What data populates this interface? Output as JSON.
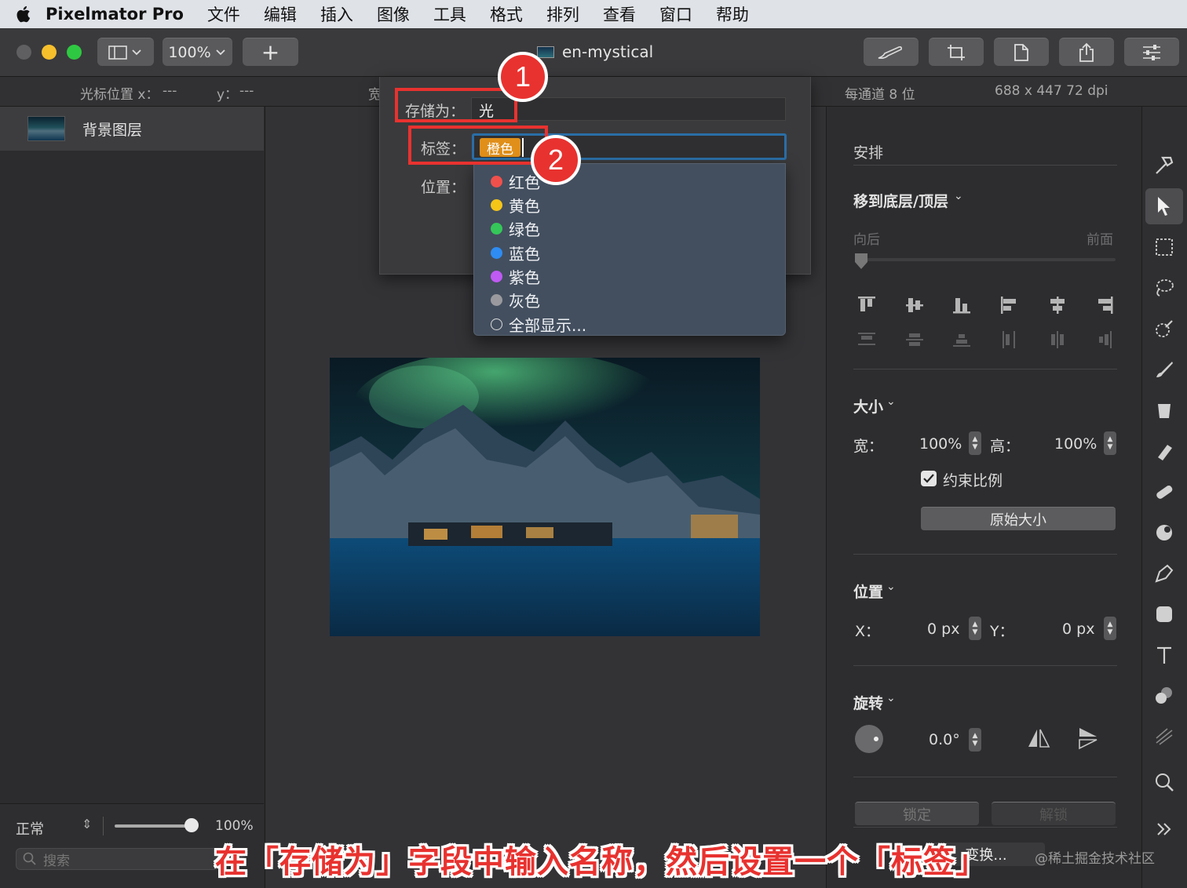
{
  "menubar": {
    "app_name": "Pixelmator Pro",
    "items": [
      "文件",
      "编辑",
      "插入",
      "图像",
      "工具",
      "格式",
      "排列",
      "查看",
      "窗口",
      "帮助"
    ]
  },
  "toolbar": {
    "zoom": "100%",
    "add_symbol": "+",
    "document_title": "en-mystical"
  },
  "infobar": {
    "cursor_x_label": "光标位置 x：",
    "cursor_x_value": "---",
    "cursor_y_label": "y：",
    "cursor_y_value": "---",
    "width_fragment": "宽",
    "bit_depth": "每通道 8 位",
    "dimensions": "688 x 447 72 dpi"
  },
  "layers": {
    "items": [
      {
        "name": "背景图层"
      }
    ],
    "blend_mode": "正常",
    "opacity": "100%",
    "opacity_level": 1.0,
    "search_placeholder": "搜索"
  },
  "dialog": {
    "save_as_label": "存储为：",
    "save_as_value": "光",
    "tags_label": "标签：",
    "tag_value": "橙色",
    "location_label": "位置：",
    "tag_options": [
      {
        "label": "红色",
        "color": "#f0504c"
      },
      {
        "label": "黄色",
        "color": "#f5c518"
      },
      {
        "label": "绿色",
        "color": "#35c759"
      },
      {
        "label": "蓝色",
        "color": "#2f8cf2"
      },
      {
        "label": "紫色",
        "color": "#bf5af2"
      },
      {
        "label": "灰色",
        "color": "#9a9a9e"
      },
      {
        "label": "全部显示...",
        "color": ""
      }
    ]
  },
  "annotations": {
    "badge1": "1",
    "badge2": "2",
    "caption": "在「存储为」字段中输入名称，然后设置一个「标签」",
    "watermark": "@稀土掘金技术社区"
  },
  "inspector": {
    "arrange_title": "安排",
    "move_section": "移到底层/顶层",
    "backward": "向后",
    "forward": "前面",
    "size_title": "大小",
    "width_label": "宽：",
    "width_value": "100%",
    "height_label": "高：",
    "height_value": "100%",
    "constrain_label": "约束比例",
    "original_size_button": "原始大小",
    "position_title": "位置",
    "x_label": "X：",
    "x_value": "0 px",
    "y_label": "Y：",
    "y_value": "0 px",
    "rotate_title": "旋转",
    "rotate_value": "0.0°",
    "lock_button": "锁定",
    "unlock_button": "解锁",
    "transform_button": "变换..."
  },
  "colors": {
    "accent_red": "#e8322f",
    "tag_orange": "#e08f1a",
    "focus_blue": "#2a6ea6"
  }
}
